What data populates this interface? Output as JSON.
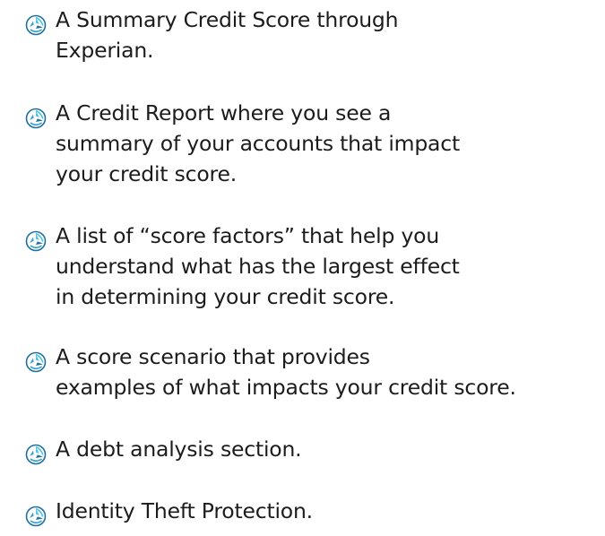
{
  "colors": {
    "icon_dark": "#1f6f9e",
    "icon_light": "#4fc3e3",
    "text": "#1c1c1c",
    "background": "#ffffff"
  },
  "icon": "tricolor-pinwheel-bullet-icon",
  "features": [
    {
      "text": "A Summary Credit Score through\nExperian."
    },
    {
      "text": "A Credit Report where you see a\nsummary of your accounts that impact\nyour credit score."
    },
    {
      "text": "A list of “score factors” that help you\nunderstand what has the largest effect\nin determining your credit score."
    },
    {
      "text": "A score scenario that provides\nexamples of what impacts your credit score."
    },
    {
      "text": "A debt analysis section."
    },
    {
      "text": "Identity Theft Protection."
    }
  ]
}
